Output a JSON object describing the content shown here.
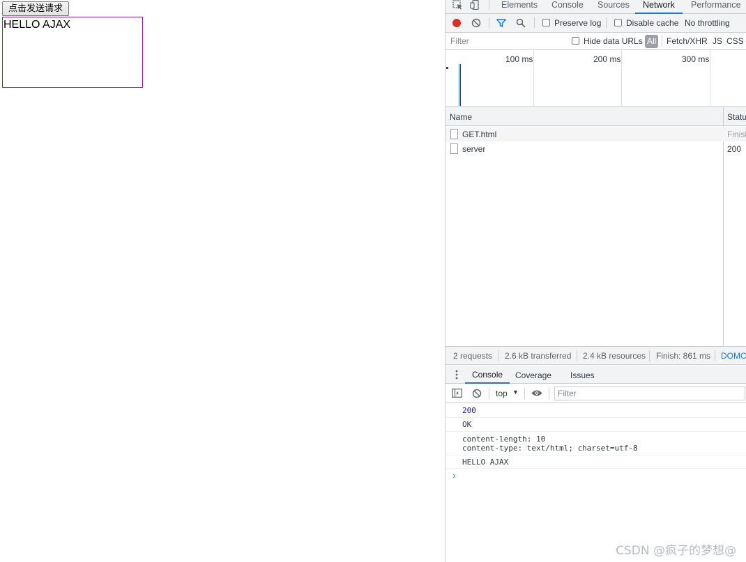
{
  "page": {
    "button_label": "点击发送请求",
    "result_text": "HELLO AJAX"
  },
  "devtools": {
    "tabs": [
      "Elements",
      "Console",
      "Sources",
      "Network",
      "Performance"
    ],
    "active_tab": "Network",
    "toolbar": {
      "preserve_log": "Preserve log",
      "disable_cache": "Disable cache",
      "throttling": "No throttling"
    },
    "filter_bar": {
      "placeholder": "Filter",
      "hide_data_urls": "Hide data URLs",
      "types": [
        "All",
        "Fetch/XHR",
        "JS",
        "CSS"
      ]
    },
    "timeline": {
      "labels": [
        "100 ms",
        "200 ms",
        "300 ms"
      ]
    },
    "table": {
      "columns": [
        "Name",
        "Statu"
      ],
      "rows": [
        {
          "name": "GET.html",
          "status": "Finish"
        },
        {
          "name": "server",
          "status": "200"
        }
      ]
    },
    "summary": {
      "requests": "2 requests",
      "transferred": "2.6 kB transferred",
      "resources": "2.4 kB resources",
      "finish": "Finish: 861 ms",
      "domc": "DOMC"
    },
    "drawer_tabs": [
      "Console",
      "Coverage",
      "Issues"
    ],
    "console_toolbar": {
      "context": "top",
      "filter_placeholder": "Filter"
    },
    "console_lines": [
      "200",
      "OK",
      "content-length: 10",
      "content-type: text/html; charset=utf-8",
      "HELLO AJAX"
    ],
    "prompt": "›"
  },
  "watermark": "CSDN @疯子的梦想@",
  "colors": {
    "accent": "#1a73e8",
    "record": "#d93025",
    "box_border": "#8b1a9a",
    "number": "#1a1aa6"
  }
}
